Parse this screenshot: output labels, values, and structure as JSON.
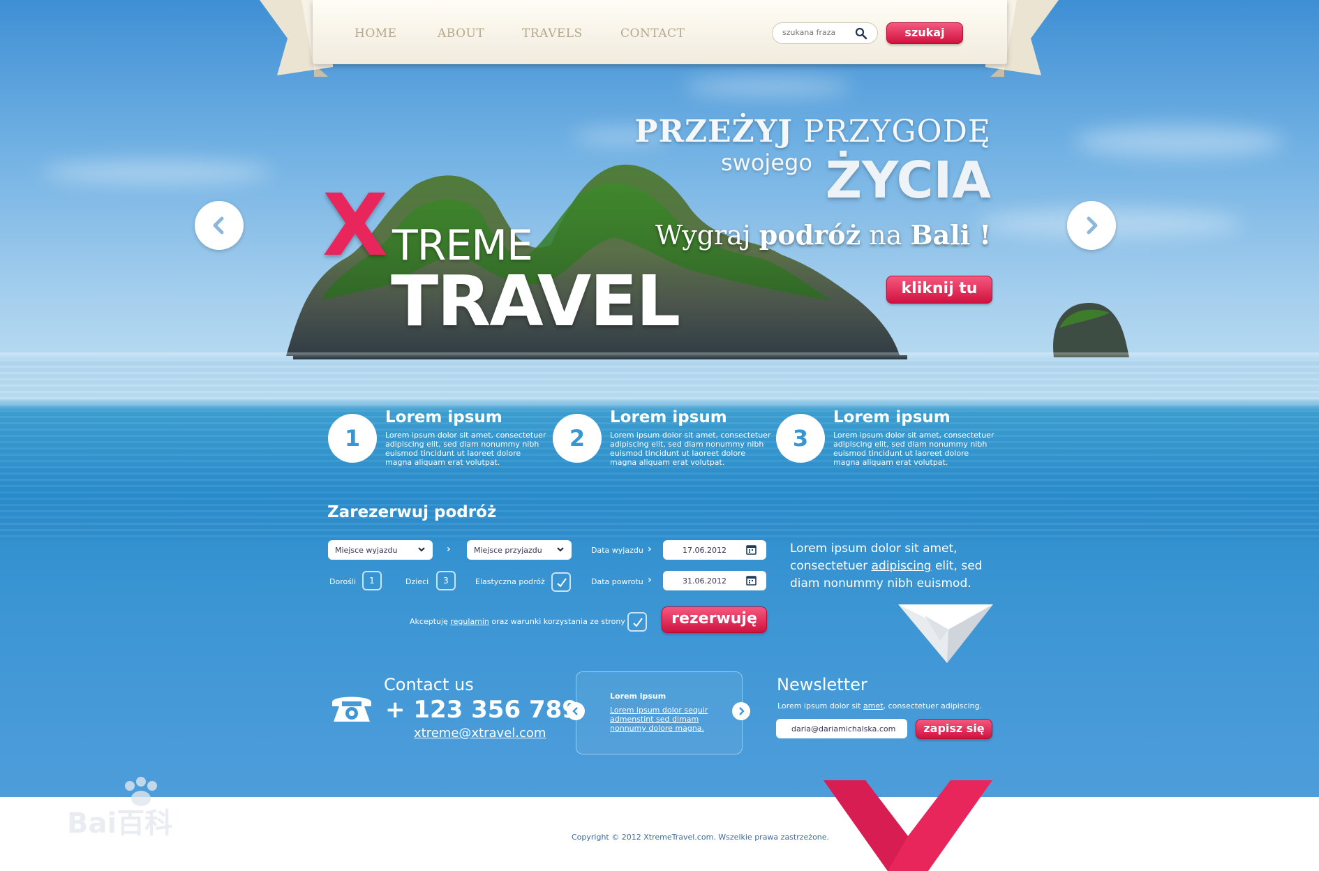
{
  "nav": {
    "items": [
      "HOME",
      "ABOUT",
      "TRAVELS",
      "CONTACT"
    ],
    "search_placeholder": "szukana fraza",
    "search_button": "szukaj"
  },
  "hero": {
    "line1_bold": "PRZEŻYJ",
    "line1_rest": " PRZYGODĘ",
    "line2_small": "swojego",
    "line2_big": "ŻYCIA",
    "line3_a": "Wygraj ",
    "line3_b": "podróż",
    "line3_c": " na ",
    "line3_d": "Bali !",
    "cta": "kliknij tu",
    "logo_x": "X",
    "logo_treme": "TREME",
    "logo_travel": "TRAVEL"
  },
  "features": [
    {
      "num": "1",
      "title": "Lorem ipsum",
      "text": "Lorem ipsum dolor sit amet, consectetuer adipiscing elit, sed diam nonummy nibh euismod tincidunt ut laoreet dolore magna aliquam erat volutpat."
    },
    {
      "num": "2",
      "title": "Lorem ipsum",
      "text": "Lorem ipsum dolor sit amet, consectetuer adipiscing elit, sed diam nonummy nibh euismod tincidunt ut laoreet dolore magna aliquam erat volutpat."
    },
    {
      "num": "3",
      "title": "Lorem ipsum",
      "text": "Lorem ipsum dolor sit amet, consectetuer adipiscing elit, sed diam nonummy nibh euismod tincidunt ut laoreet dolore magna aliquam erat volutpat."
    }
  ],
  "booking": {
    "title": "Zarezerwuj podróż",
    "departure_place": "Miejsce wyjazdu",
    "arrival_place": "Miejsce przyjazdu",
    "departure_date_label": "Data wyjazdu",
    "departure_date": "17.06.2012",
    "return_date_label": "Data powrotu",
    "return_date": "31.06.2012",
    "adults_label": "Dorośli",
    "adults": "1",
    "children_label": "Dzieci",
    "children": "3",
    "flexible_label": "Elastyczna podróż",
    "accept_a": "Akceptuję ",
    "accept_link": "regulamin",
    "accept_b": " oraz warunki korzystania ze strony",
    "submit": "rezerwuję"
  },
  "side": {
    "text_a": "Lorem ipsum dolor sit amet, consectetuer ",
    "text_link": "adipiscing",
    "text_b": " elit, sed diam nonummy nibh euismod."
  },
  "contact": {
    "title": "Contact us",
    "phone": "+ 123 356 789",
    "email": "xtreme@xtravel.com"
  },
  "mini": {
    "title": "Lorem ipsum",
    "text": "Lorem ipsum dolor sequir admenstint sed dimam nonnumy dolore magna."
  },
  "newsletter": {
    "title": "Newsletter",
    "text_a": "Lorem ipsum dolor sit ",
    "text_link": "amet",
    "text_b": ", consectetuer adipiscing.",
    "email_value": "daria@dariamichalska.com",
    "button": "zapisz się"
  },
  "footer": {
    "copyright": "Copyright © 2012 XtremeTravel.com. Wszelkie prawa zastrzeżone."
  },
  "watermark": {
    "text": "Bai百科"
  },
  "colors": {
    "accent_pink": "#e8265c",
    "ocean_blue": "#3e96d4"
  }
}
